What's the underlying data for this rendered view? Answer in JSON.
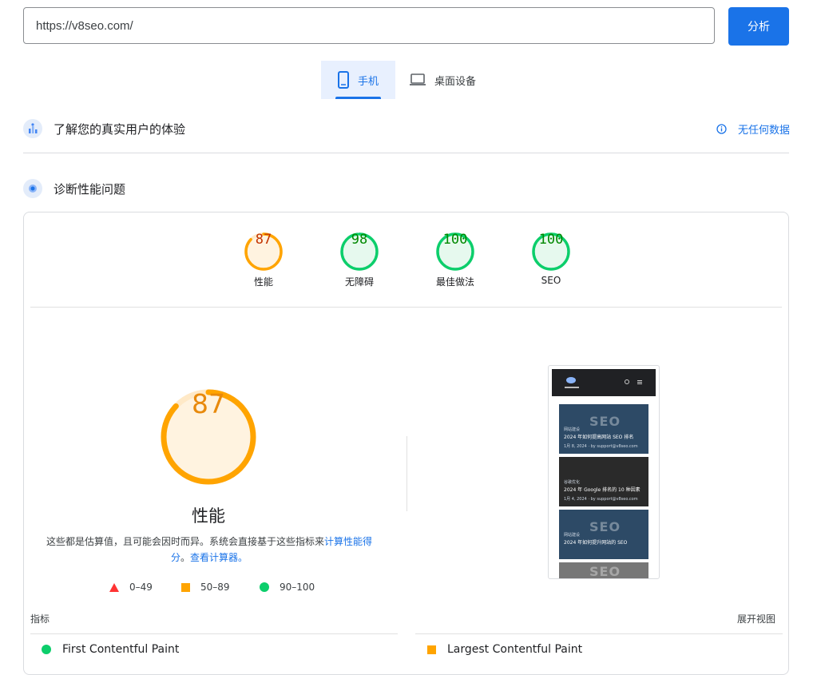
{
  "search": {
    "value": "https://v8seo.com/",
    "button_label": "分析"
  },
  "device_tabs": [
    {
      "label": "手机",
      "icon": "smartphone-icon",
      "active": true
    },
    {
      "label": "桌面设备",
      "icon": "laptop-icon",
      "active": false
    }
  ],
  "field_section": {
    "title": "了解您的真实用户的体验",
    "no_data_label": "无任何数据"
  },
  "lab_section": {
    "title": "诊断性能问题"
  },
  "categories": [
    {
      "label": "性能",
      "score": "87",
      "level": "average"
    },
    {
      "label": "无障碍",
      "score": "98",
      "level": "pass"
    },
    {
      "label": "最佳做法",
      "score": "100",
      "level": "pass"
    },
    {
      "label": "SEO",
      "score": "100",
      "level": "pass"
    }
  ],
  "performance": {
    "score": "87",
    "label": "性能",
    "description_prefix": "这些都是估算值，且可能会因时而异。系统会直接基于这些指标来",
    "calc_link": "计算性能得分",
    "description_sep": "。",
    "calculator_link": "查看计算器。"
  },
  "legend": [
    {
      "range": "0–49",
      "icon": "fail-triangle-icon"
    },
    {
      "range": "50–89",
      "icon": "average-square-icon"
    },
    {
      "range": "90–100",
      "icon": "pass-circle-icon"
    }
  ],
  "metrics": {
    "header": "指标",
    "expand_label": "展开视图",
    "items": [
      {
        "name": "First Contentful Paint",
        "status": "pass"
      },
      {
        "name": "Largest Contentful Paint",
        "status": "average"
      }
    ]
  },
  "colors": {
    "accent": "#1a73e8",
    "pass": "#0cce6b",
    "average": "#ffa400",
    "fail": "#ff4e42"
  }
}
